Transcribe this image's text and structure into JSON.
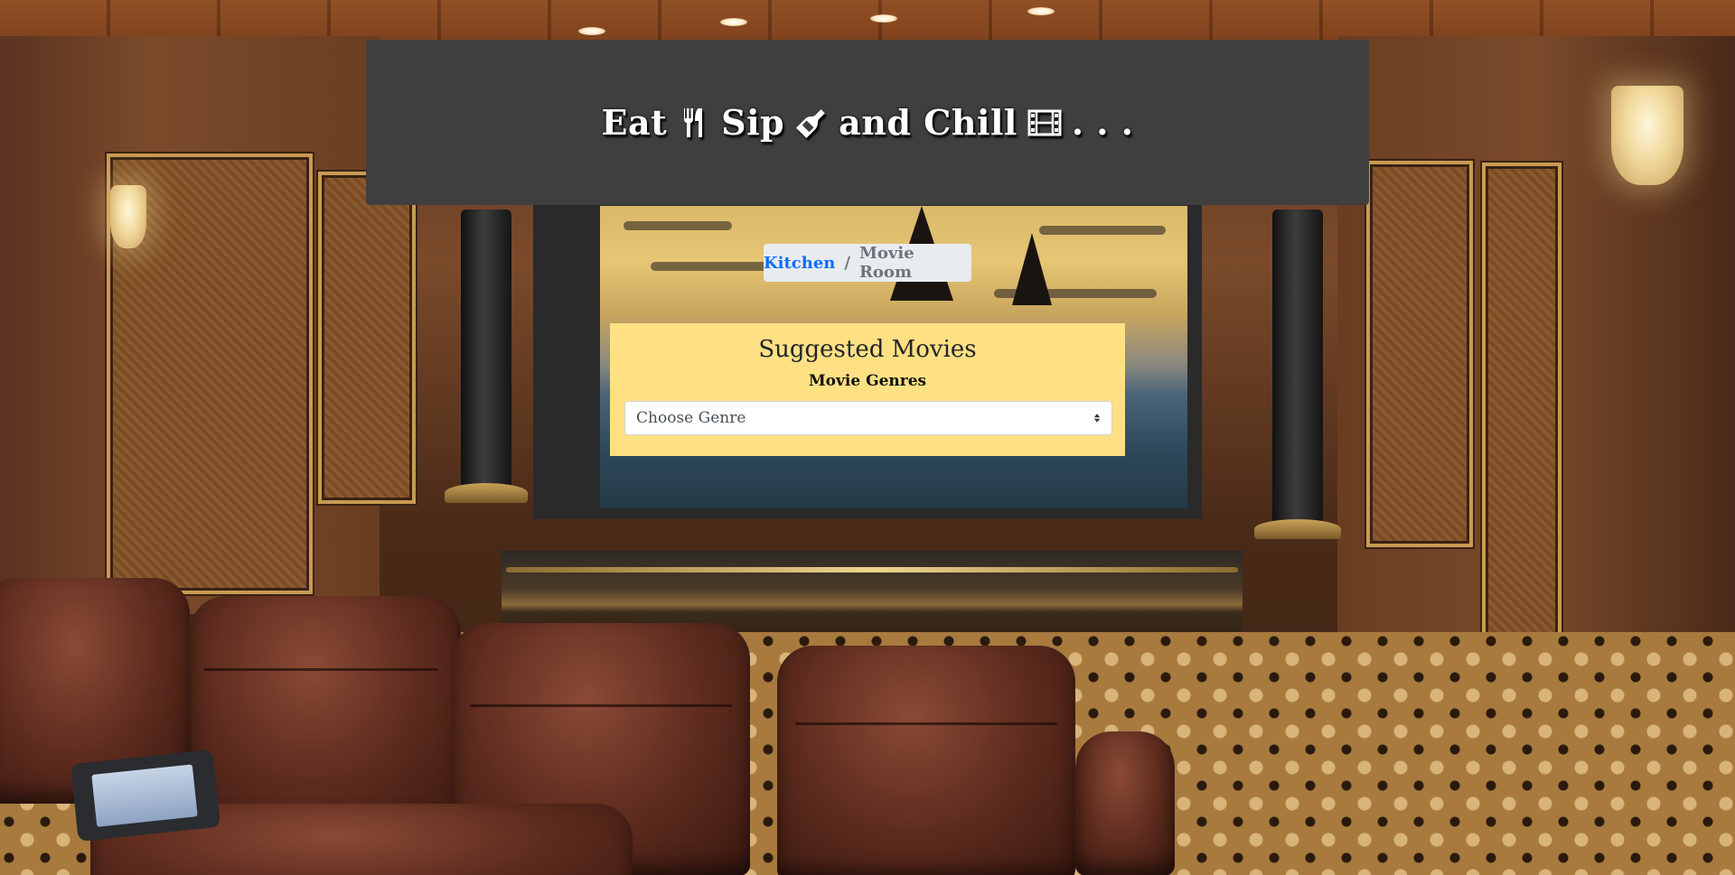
{
  "header": {
    "title_parts": [
      "Eat",
      "Sip",
      "and Chill",
      ". . ."
    ],
    "icons": [
      "fork-knife-icon",
      "wine-bottle-icon",
      "film-icon"
    ]
  },
  "breadcrumb": {
    "items": [
      {
        "label": "Kitchen",
        "link": true
      },
      {
        "label": "Movie Room",
        "link": false
      }
    ],
    "separator": "/"
  },
  "movies_card": {
    "title": "Suggested Movies",
    "subtitle": "Movie Genres",
    "genre_select": {
      "selected": "Choose Genre"
    }
  },
  "colors": {
    "header_bg": "#3f3f3f",
    "card_bg": "#ffe083",
    "link": "#0d6efd",
    "breadcrumb_bg": "#e9ecef"
  }
}
